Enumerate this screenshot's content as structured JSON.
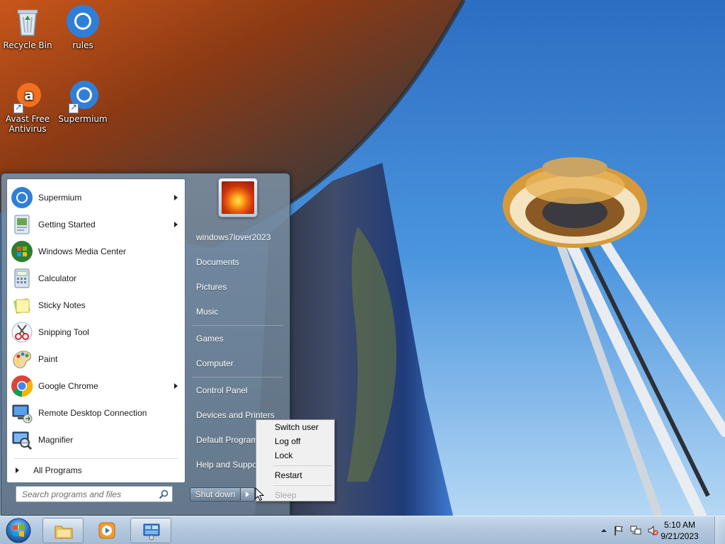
{
  "desktop": {
    "icons": [
      {
        "label": "Recycle Bin",
        "icon": "recycle-bin-icon"
      },
      {
        "label": "rules",
        "icon": "chromium-icon"
      },
      {
        "label": "Avast Free Antivirus",
        "icon": "avast-icon"
      },
      {
        "label": "Supermium",
        "icon": "supermium-icon"
      }
    ]
  },
  "start_menu": {
    "programs": [
      {
        "label": "Supermium",
        "icon": "supermium-icon",
        "submenu": true
      },
      {
        "label": "Getting Started",
        "icon": "getting-started-icon",
        "submenu": true
      },
      {
        "label": "Windows Media Center",
        "icon": "media-center-icon",
        "submenu": false
      },
      {
        "label": "Calculator",
        "icon": "calculator-icon",
        "submenu": false
      },
      {
        "label": "Sticky Notes",
        "icon": "sticky-notes-icon",
        "submenu": false
      },
      {
        "label": "Snipping Tool",
        "icon": "snipping-tool-icon",
        "submenu": false
      },
      {
        "label": "Paint",
        "icon": "paint-icon",
        "submenu": false
      },
      {
        "label": "Google Chrome",
        "icon": "chrome-icon",
        "submenu": true
      },
      {
        "label": "Remote Desktop Connection",
        "icon": "remote-desktop-icon",
        "submenu": false
      },
      {
        "label": "Magnifier",
        "icon": "magnifier-icon",
        "submenu": false
      }
    ],
    "all_programs": "All Programs",
    "search_placeholder": "Search programs and files",
    "right_links": {
      "user": "windows7lover2023",
      "documents": "Documents",
      "pictures": "Pictures",
      "music": "Music",
      "games": "Games",
      "computer": "Computer",
      "control_panel": "Control Panel",
      "devices": "Devices and Printers",
      "default_programs": "Default Programs",
      "help": "Help and Support"
    },
    "shutdown_label": "Shut down"
  },
  "power_menu": {
    "switch_user": "Switch user",
    "log_off": "Log off",
    "lock": "Lock",
    "restart": "Restart",
    "sleep": "Sleep"
  },
  "taskbar": {
    "clock_time": "5:10 AM",
    "clock_date": "9/21/2023"
  },
  "colors": {
    "start_menu_glass": "#6f8499",
    "taskbar": "#b3c8de",
    "sky": "#4a93dd"
  }
}
